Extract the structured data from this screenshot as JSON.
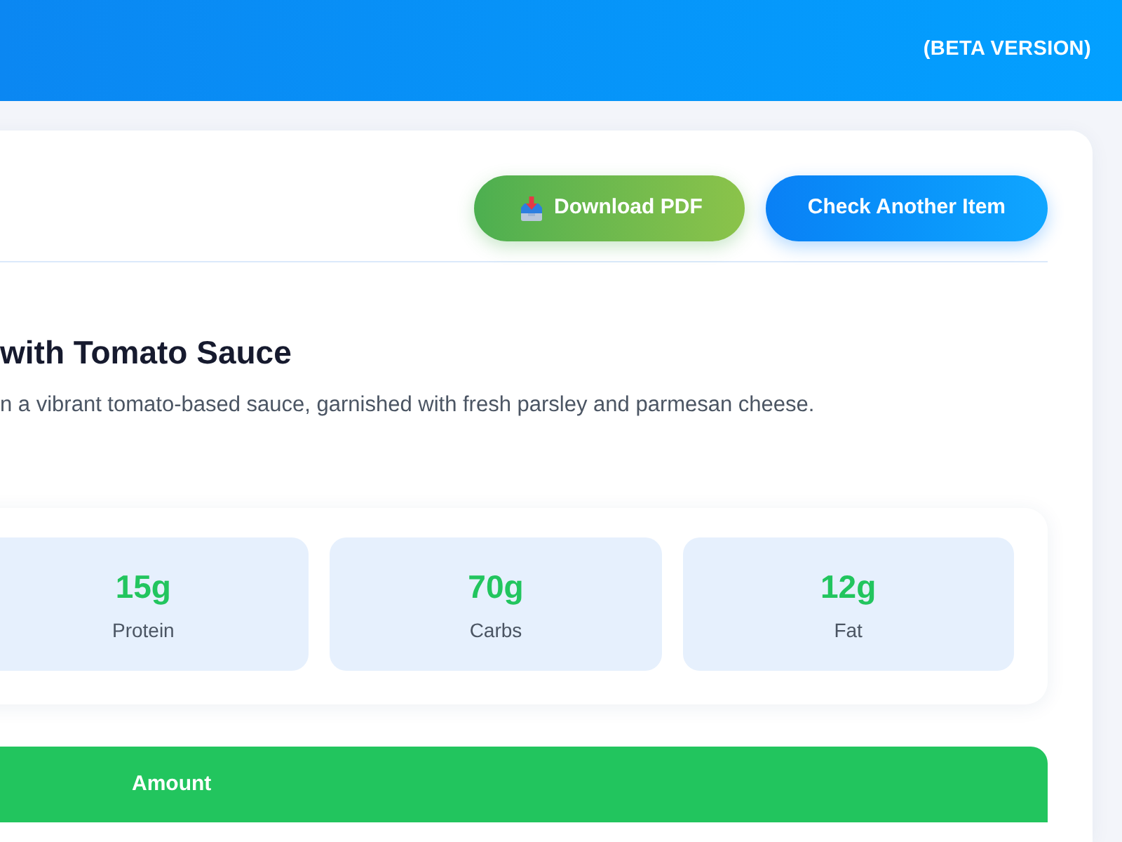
{
  "header": {
    "badge": "(BETA VERSION)"
  },
  "actions": [
    {
      "kind": "download",
      "label": "Download PDF"
    },
    {
      "kind": "reset",
      "label": "Check Another Item"
    }
  ],
  "dish": {
    "title": "with Tomato Sauce",
    "description": "n a vibrant tomato-based sauce, garnished with fresh parsley and parmesan cheese."
  },
  "macros": [
    {
      "value": "15g",
      "label": "Protein"
    },
    {
      "value": "70g",
      "label": "Carbs"
    },
    {
      "value": "12g",
      "label": "Fat"
    }
  ],
  "table": {
    "columns": [
      {
        "label": "Amount"
      }
    ]
  }
}
